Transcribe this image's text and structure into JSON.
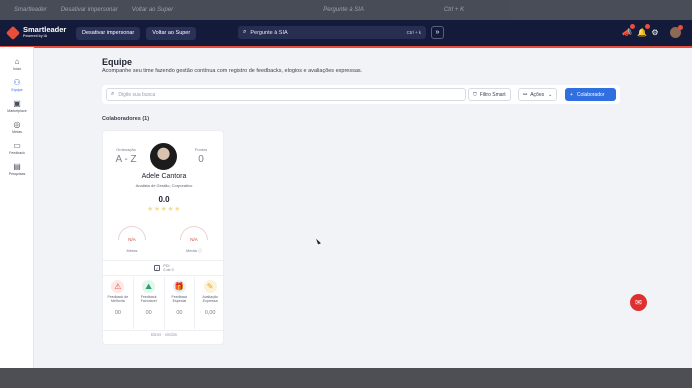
{
  "ghost": {
    "items": [
      "Smartleader",
      "Desativar impersonar",
      "Voltar ao Super",
      "Pergunte à SIA",
      "Ctrl + K"
    ]
  },
  "topbar": {
    "logo": "Smartleader",
    "logo_sub": "Powered by IA",
    "impersonate_btn": "Desativar impersonar",
    "super_btn": "Voltar ao Super",
    "search_placeholder": "Pergunte à SIA",
    "search_shortcut": "Ctrl + k"
  },
  "sidebar": {
    "items": [
      {
        "label": "Início",
        "icon": "home-icon",
        "glyph": "⌂"
      },
      {
        "label": "Equipe",
        "icon": "team-icon",
        "glyph": "⚇"
      },
      {
        "label": "Marketplace",
        "icon": "marketplace-icon",
        "glyph": "▣"
      },
      {
        "label": "Metas",
        "icon": "goals-icon",
        "glyph": "◎"
      },
      {
        "label": "Feedback",
        "icon": "feedback-icon",
        "glyph": "▭"
      },
      {
        "label": "Pesquisas",
        "icon": "surveys-icon",
        "glyph": "▤"
      }
    ]
  },
  "page": {
    "title": "Equipe",
    "subtitle": "Acompanhe seu time fazendo gestão contínua com registro de feedbacks, elogios e avaliações expressas.",
    "search_placeholder": "Digite sua busca",
    "filter_btn": "Filtro Smart",
    "actions_btn": "Ações",
    "add_btn": "Colaborador",
    "count_label": "Colaboradores (1)"
  },
  "card": {
    "order_label": "Ordenação",
    "order_value": "A - Z",
    "points_label": "Pontos",
    "points_value": "0",
    "name": "Adele Cantora",
    "role": "Analista de Gestão, Corporativo",
    "score": "0.0",
    "stars": "★★★★★",
    "goals_value": "N/A",
    "goals_label": "Metas",
    "avg_value": "N/A",
    "avg_label": "Média",
    "pdi_label": "PDI",
    "pdi_value": "0 de 0",
    "feedbacks": [
      {
        "label": "Feedback de Melhoria",
        "value": "00",
        "icon": "improvement-feedback-icon",
        "glyph": "⚠",
        "color": "#e94e3c",
        "bg": "#fde8e6"
      },
      {
        "label": "Feedback Favorável",
        "value": "00",
        "icon": "positive-feedback-icon",
        "glyph": "⛰",
        "color": "#27a36a",
        "bg": "#e3f5ec"
      },
      {
        "label": "Feedback Especial",
        "value": "00",
        "icon": "special-feedback-icon",
        "glyph": "🎁",
        "color": "#2f6fe0",
        "bg": "#e6eefc"
      },
      {
        "label": "Avaliação Expressa",
        "value": "0,00",
        "icon": "express-eval-icon",
        "glyph": "✎",
        "color": "#e0a81c",
        "bg": "#fcf2d9"
      }
    ],
    "footer": "Bizos · vindos"
  }
}
